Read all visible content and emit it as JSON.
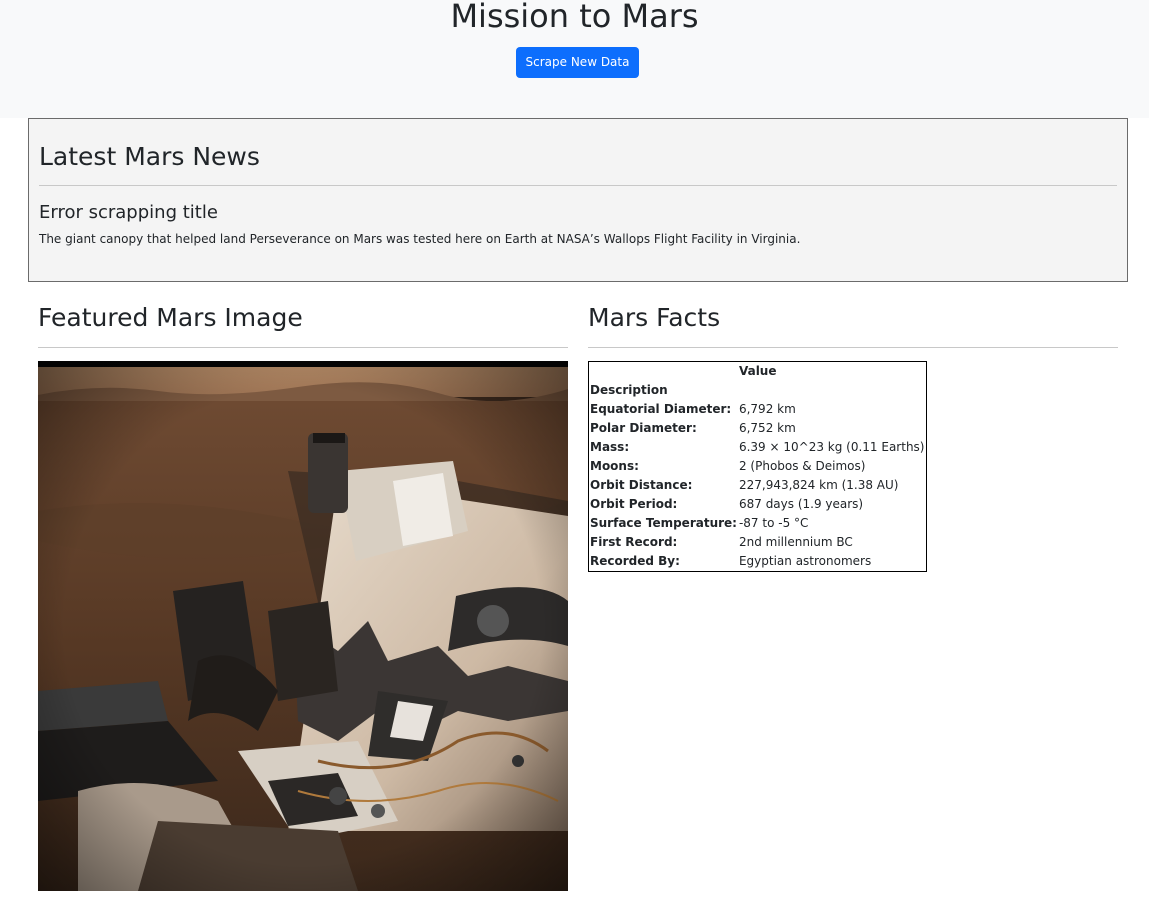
{
  "header": {
    "title": "Mission to Mars",
    "scrape_button_label": "Scrape New Data"
  },
  "news": {
    "heading": "Latest Mars News",
    "title": "Error scrapping title",
    "paragraph": "The giant canopy that helped land Perseverance on Mars was tested here on Earth at NASA’s Wallops Flight Facility in Virginia."
  },
  "featured": {
    "heading": "Featured Mars Image"
  },
  "facts": {
    "heading": "Mars Facts",
    "column_header": "Value",
    "index_header": "Description",
    "rows": [
      {
        "label": "Equatorial Diameter:",
        "value": "6,792 km"
      },
      {
        "label": "Polar Diameter:",
        "value": "6,752 km"
      },
      {
        "label": "Mass:",
        "value": "6.39 × 10^23 kg (0.11 Earths)"
      },
      {
        "label": "Moons:",
        "value": "2 (Phobos & Deimos)"
      },
      {
        "label": "Orbit Distance:",
        "value": "227,943,824 km (1.38 AU)"
      },
      {
        "label": "Orbit Period:",
        "value": "687 days (1.9 years)"
      },
      {
        "label": "Surface Temperature:",
        "value": "-87 to -5 °C"
      },
      {
        "label": "First Record:",
        "value": "2nd millennium BC"
      },
      {
        "label": "Recorded By:",
        "value": "Egyptian astronomers"
      }
    ]
  },
  "colors": {
    "button": "#0d6efd",
    "jumbotron_bg": "#f8f9fa",
    "news_bg": "#f4f4f4"
  }
}
